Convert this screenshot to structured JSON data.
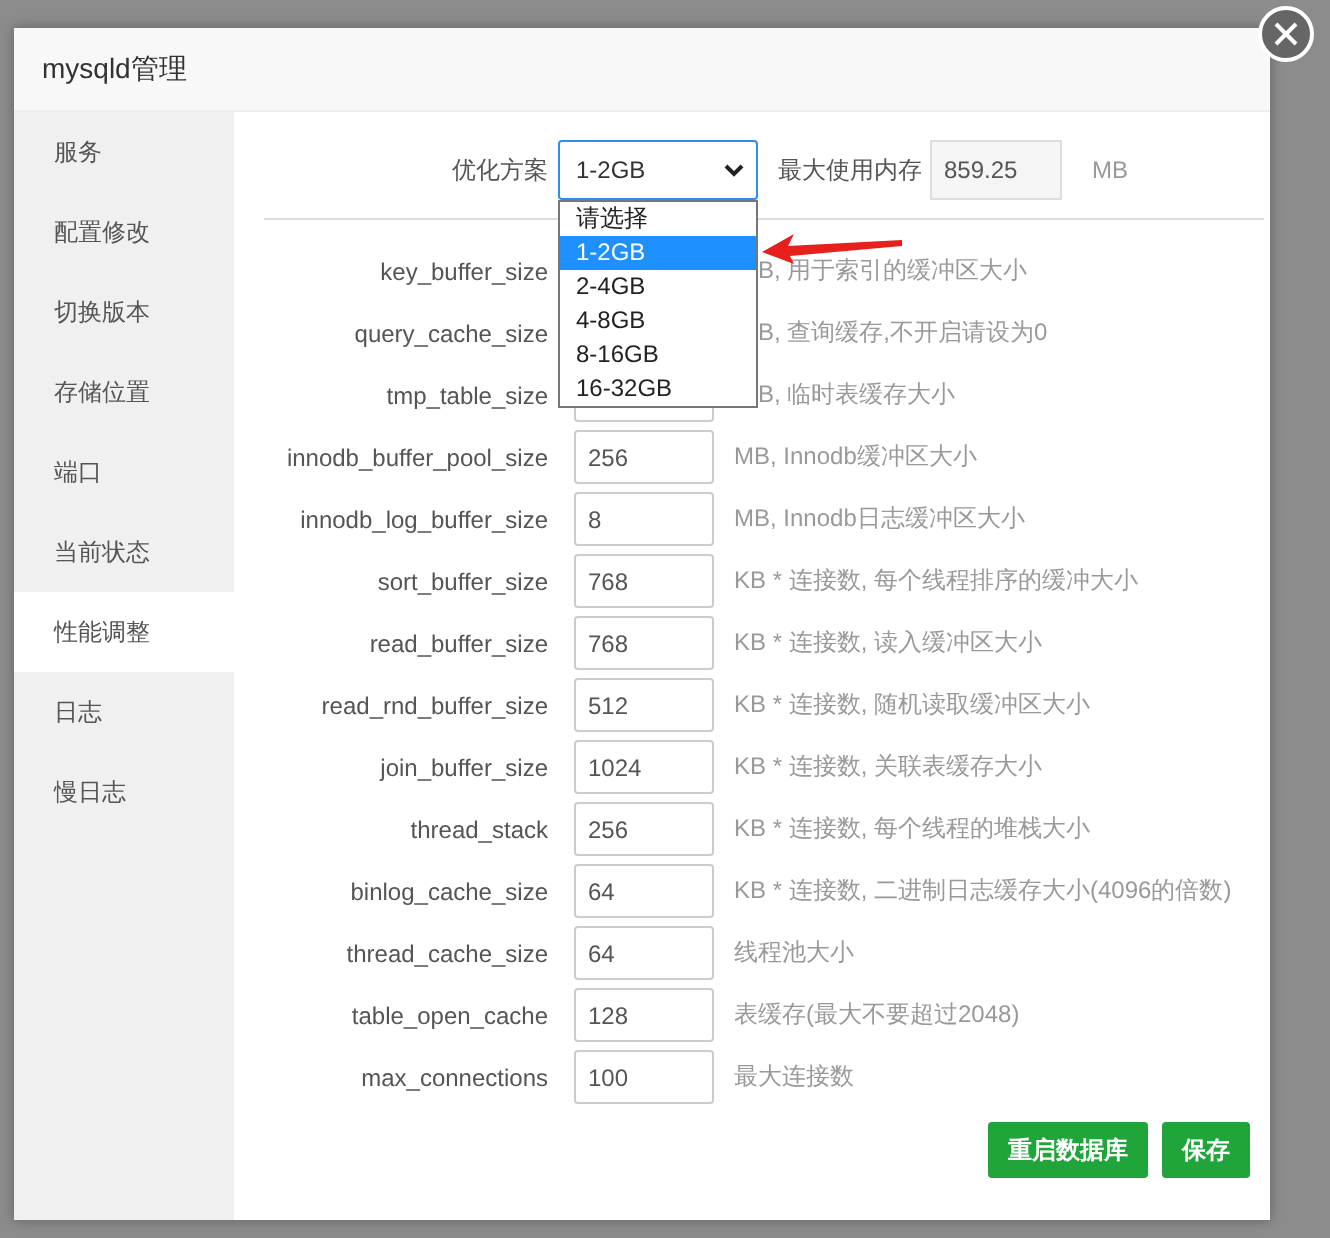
{
  "window": {
    "title": "mysqld管理"
  },
  "sidebar": {
    "items": [
      {
        "label": "服务",
        "selected": false
      },
      {
        "label": "配置修改",
        "selected": false
      },
      {
        "label": "切换版本",
        "selected": false
      },
      {
        "label": "存储位置",
        "selected": false
      },
      {
        "label": "端口",
        "selected": false
      },
      {
        "label": "当前状态",
        "selected": false
      },
      {
        "label": "性能调整",
        "selected": true
      },
      {
        "label": "日志",
        "selected": false
      },
      {
        "label": "慢日志",
        "selected": false
      }
    ]
  },
  "optimization": {
    "label": "优化方案",
    "value": "1-2GB",
    "expanded": true,
    "options": [
      {
        "label": "请选择",
        "selected": false
      },
      {
        "label": "1-2GB",
        "selected": true
      },
      {
        "label": "2-4GB",
        "selected": false
      },
      {
        "label": "4-8GB",
        "selected": false
      },
      {
        "label": "8-16GB",
        "selected": false
      },
      {
        "label": "16-32GB",
        "selected": false
      }
    ]
  },
  "max_memory": {
    "label": "最大使用内存",
    "value": "859.25",
    "unit": "MB"
  },
  "parameters": [
    {
      "label": "key_buffer_size",
      "hint": "B, 用于索引的缓冲区大小"
    },
    {
      "label": "query_cache_size",
      "hint": "B, 查询缓存,不开启请设为0"
    },
    {
      "label": "tmp_table_size",
      "hint": "B, 临时表缓存大小"
    },
    {
      "label": "innodb_buffer_pool_size",
      "value": "256",
      "hint": "MB, Innodb缓冲区大小"
    },
    {
      "label": "innodb_log_buffer_size",
      "value": "8",
      "hint": "MB, Innodb日志缓冲区大小"
    },
    {
      "label": "sort_buffer_size",
      "value": "768",
      "hint": "KB * 连接数, 每个线程排序的缓冲大小"
    },
    {
      "label": "read_buffer_size",
      "value": "768",
      "hint": "KB * 连接数, 读入缓冲区大小"
    },
    {
      "label": "read_rnd_buffer_size",
      "value": "512",
      "hint": "KB * 连接数, 随机读取缓冲区大小"
    },
    {
      "label": "join_buffer_size",
      "value": "1024",
      "hint": "KB * 连接数, 关联表缓存大小"
    },
    {
      "label": "thread_stack",
      "value": "256",
      "hint": "KB * 连接数, 每个线程的堆栈大小"
    },
    {
      "label": "binlog_cache_size",
      "value": "64",
      "hint": "KB * 连接数, 二进制日志缓存大小(4096的倍数)"
    },
    {
      "label": "thread_cache_size",
      "value": "64",
      "hint": "线程池大小"
    },
    {
      "label": "table_open_cache",
      "value": "128",
      "hint": "表缓存(最大不要超过2048)"
    },
    {
      "label": "max_connections",
      "value": "100",
      "hint": "最大连接数"
    }
  ],
  "buttons": [
    {
      "label": "重启数据库"
    },
    {
      "label": "保存"
    }
  ]
}
